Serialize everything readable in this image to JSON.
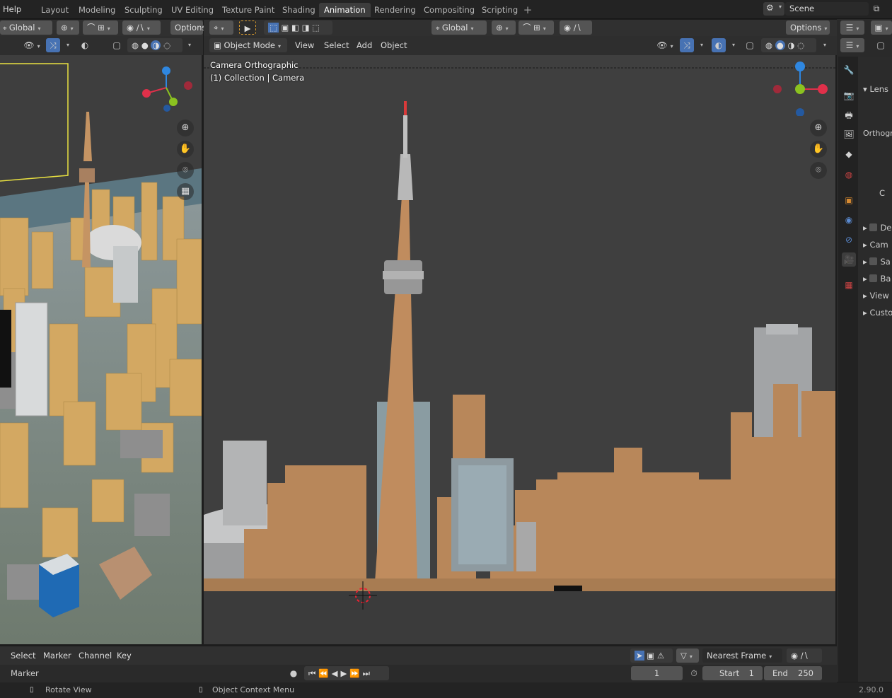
{
  "menu": {
    "help": "Help"
  },
  "workspace_tabs": [
    "Layout",
    "Modeling",
    "Sculpting",
    "UV Editing",
    "Texture Paint",
    "Shading",
    "Animation",
    "Rendering",
    "Compositing",
    "Scripting"
  ],
  "active_tab": "Animation",
  "scene": {
    "name": "Scene"
  },
  "left_header": {
    "orientation": "Global",
    "options": "Options"
  },
  "main_header": {
    "orientation": "Global",
    "options": "Options",
    "mode": "Object Mode",
    "menus": [
      "View",
      "Select",
      "Add",
      "Object"
    ]
  },
  "viewport": {
    "camera_label": "Camera Orthographic",
    "collection_label": "(1) Collection | Camera"
  },
  "properties": {
    "lens": "Lens",
    "orthographic_partial": "Orthogra",
    "c_partial": "C",
    "rows": [
      "De",
      "Cam",
      "Sa",
      "Ba",
      "View",
      "Custo"
    ]
  },
  "timeline": {
    "menus": [
      "Select",
      "Marker",
      "Channel",
      "Key"
    ],
    "interpolation": "Nearest Frame",
    "marker": "Marker",
    "current_frame": "1",
    "start_label": "Start",
    "start": "1",
    "end_label": "End",
    "end": "250"
  },
  "status": {
    "rotate": "Rotate View",
    "context": "Object Context Menu",
    "version": "2.90.0"
  },
  "colors": {
    "active_blue": "#4772b3",
    "building": "#b8875a",
    "axis_x": "#e0304a",
    "axis_y": "#8bc220",
    "axis_z": "#2f87e0"
  },
  "icons": [
    "scene-icon",
    "snap-icon",
    "proportional-icon",
    "zoom-icon",
    "hand-icon",
    "camera-icon",
    "grid-icon",
    "play-icon",
    "jump-start-icon",
    "jump-end-icon",
    "record-icon",
    "filter-icon",
    "stopwatch-icon"
  ]
}
